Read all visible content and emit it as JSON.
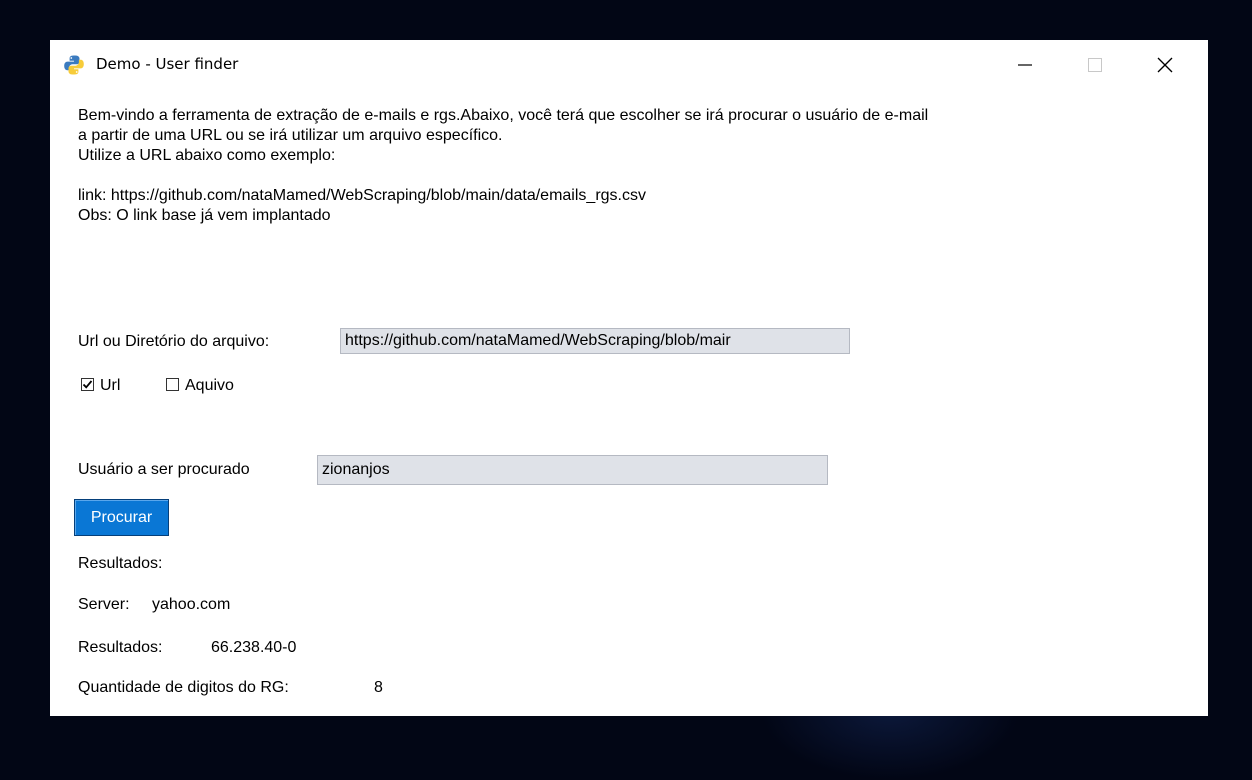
{
  "window": {
    "title": "Demo - User finder"
  },
  "intro": {
    "text": "Bem-vindo a ferramenta de extração de e-mails e rgs.Abaixo, você terá que escolher se irá procurar o usuário de e-mail\na partir de uma URL ou se irá utilizar um arquivo específico.\nUtilize a URL abaixo como exemplo:\n\nlink: https://github.com/nataMamed/WebScraping/blob/main/data/emails_rgs.csv\nObs: O link base já vem implantado"
  },
  "source": {
    "label": "Url ou Diretório do arquivo:",
    "value": "https://github.com/nataMamed/WebScraping/blob/mair"
  },
  "options": [
    {
      "label": "Url",
      "checked": true
    },
    {
      "label": "Aquivo",
      "checked": false
    }
  ],
  "user": {
    "label": "Usuário a ser procurado",
    "value": "zionanjos"
  },
  "search_button": {
    "label": "Procurar"
  },
  "results": {
    "heading": "Resultados:",
    "server_label": "Server:",
    "server_value": "yahoo.com",
    "result_label": "Resultados:",
    "result_value": "66.238.40-0",
    "rg_label": "Quantidade de digitos do RG:",
    "rg_value": "8"
  },
  "colors": {
    "accent": "#0a77d5",
    "field_bg": "#dfe2e8",
    "desktop_bg": "#020615"
  },
  "icons": {
    "app": "python-logo-icon",
    "minimize": "minimize-icon",
    "maximize": "maximize-icon",
    "close": "close-icon",
    "checked": "checkbox-checked-icon",
    "unchecked": "checkbox-unchecked-icon"
  }
}
